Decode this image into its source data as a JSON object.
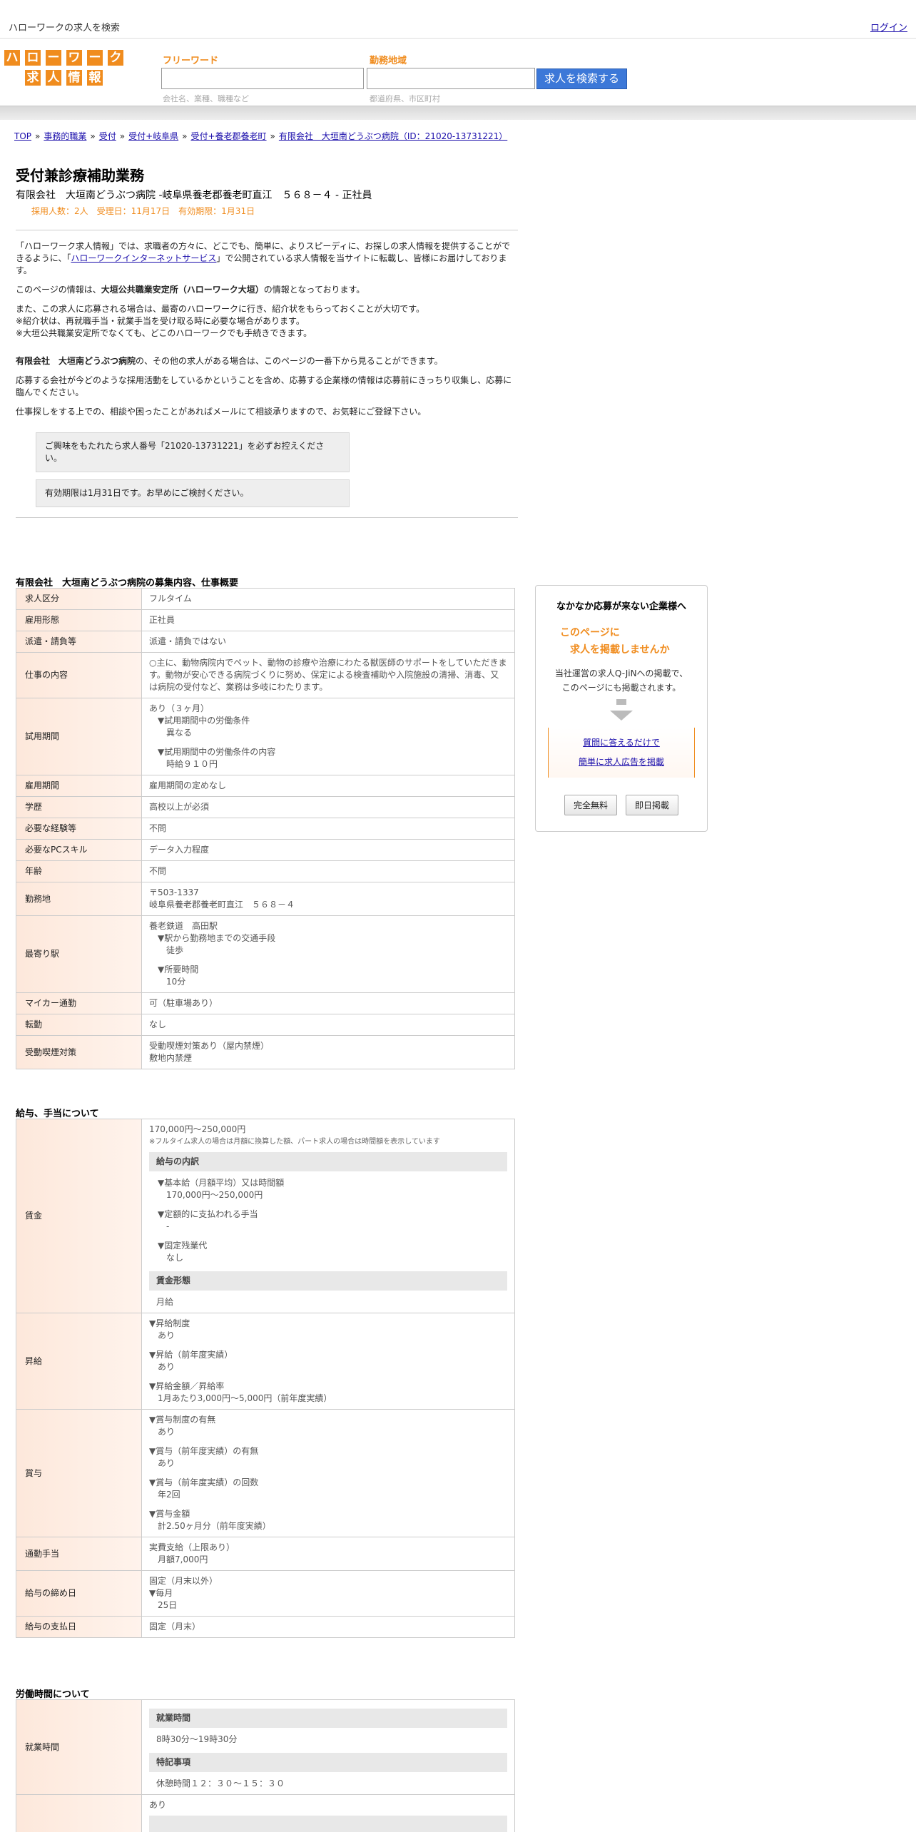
{
  "topbar": {
    "site_title": "ハローワークの求人を検索",
    "login": "ログイン"
  },
  "logo": {
    "row1": [
      "ハ",
      "ロ",
      "ー",
      "ワ",
      "ー",
      "ク"
    ],
    "row2": [
      "求",
      "人",
      "情",
      "報"
    ]
  },
  "search": {
    "freeword_label": "フリーワード",
    "freeword_placeholder": "会社名、業種、職種など",
    "area_label": "勤務地域",
    "area_placeholder": "都道府県、市区町村",
    "button": "求人を検索する"
  },
  "breadcrumb": [
    "TOP",
    "事務的職業",
    "受付",
    "受付+岐阜県",
    "受付+養老郡養老町",
    "有限会社　大垣南どうぶつ病院（ID：21020-13731221）"
  ],
  "job": {
    "title": "受付兼診療補助業務",
    "subtitle": "有限会社　大垣南どうぶつ病院 -岐阜県養老郡養老町直江　５６８－４ - 正社員",
    "meta": "採用人数：2人　受理日：11月17日　有効期限：1月31日"
  },
  "intro": {
    "p1_a": "「ハローワーク求人情報」では、求職者の方々に、どこでも、簡単に、よりスピーディに、お探しの求人情報を提供することができるように、「",
    "p1_link": "ハローワークインターネットサービス",
    "p1_b": "」で公開されている求人情報を当サイトに転載し、皆様にお届けしております。",
    "p2_a": "このページの情報は、",
    "p2_bold": "大垣公共職業安定所（ハローワーク大垣）",
    "p2_b": "の情報となっております。",
    "p3_l1": "また、この求人に応募される場合は、最寄のハローワークに行き、紹介状をもらっておくことが大切です。",
    "p3_l2": "※紹介状は、再就職手当・就業手当を受け取る時に必要な場合があります。",
    "p3_l3": "※大垣公共職業安定所でなくても、どこのハローワークでも手続きできます。",
    "p4_bold": "有限会社　大垣南どうぶつ病院",
    "p4_rest": "の、その他の求人がある場合は、このページの一番下から見ることができます。",
    "p5": "応募する会社が今どのような採用活動をしているかということを含め、応募する企業様の情報は応募前にきっちり収集し、応募に臨んでください。",
    "p6": "仕事探しをする上での、相談や困ったことがあればメールにて相談承りますので、お気軽にご登録下さい。",
    "notice1": "ご興味をもたれたら求人番号「21020-13731221」を必ずお控えください。",
    "notice2": "有効期限は1月31日です。お早めにご検討ください。"
  },
  "overview": {
    "heading": "有限会社　大垣南どうぶつ病院の募集内容、仕事概要",
    "rows": {
      "kubun": [
        "求人区分",
        "フルタイム"
      ],
      "koyo": [
        "雇用形態",
        "正社員"
      ],
      "haken": [
        "派遣・請負等",
        "派遣・請負ではない"
      ],
      "shigoto": [
        "仕事の内容",
        "○主に、動物病院内でペット、動物の診療や治療にわたる獣医師のサポートをしていただきます。動物が安心できる病院づくりに努め、保定による検査補助や入院施設の清掃、消毒、又は病院の受付など、業務は多岐にわたります。"
      ],
      "shiyo_k": "試用期間",
      "shiyo_1": "あり（３ヶ月）",
      "shiyo_2": "▼試用期間中の労働条件",
      "shiyo_3": "異なる",
      "shiyo_4": "▼試用期間中の労働条件の内容",
      "shiyo_5": "時給９１０円",
      "kikan": [
        "雇用期間",
        "雇用期間の定めなし"
      ],
      "gakureki": [
        "学歴",
        "高校以上が必須"
      ],
      "keiken": [
        "必要な経験等",
        "不問"
      ],
      "pc": [
        "必要なPCスキル",
        "データ入力程度"
      ],
      "nenrei": [
        "年齢",
        "不問"
      ],
      "kinmu_k": "勤務地",
      "kinmu_1": "〒503-1337",
      "kinmu_2": "岐阜県養老郡養老町直江　５６８－４",
      "eki_k": "最寄り駅",
      "eki_1": "養老鉄道　高田駅",
      "eki_2": "▼駅から勤務地までの交通手段",
      "eki_3": "徒歩",
      "eki_4": "▼所要時間",
      "eki_5": "10分",
      "mycar": [
        "マイカー通勤",
        "可（駐車場あり）"
      ],
      "tenkin": [
        "転勤",
        "なし"
      ],
      "judo_k": "受動喫煙対策",
      "judo_1": "受動喫煙対策あり（屋内禁煙）",
      "judo_2": "敷地内禁煙"
    }
  },
  "salary": {
    "heading": "給与、手当について",
    "chingin_k": "賃金",
    "chingin_range": "170,000円〜250,000円",
    "chingin_note": "※フルタイム求人の場合は月額に換算した額、パート求人の場合は時間額を表示しています",
    "uchiwake_h": "給与の内訳",
    "kihon_l": "▼基本給（月額平均）又は時間額",
    "kihon_v": "170,000円〜250,000円",
    "teigaku_l": "▼定額的に支払われる手当",
    "teigaku_v": "-",
    "kotei_l": "▼固定残業代",
    "kotei_v": "なし",
    "keitai_h": "賃金形態",
    "keitai_v": "月給",
    "shokyu_k": "昇給",
    "shokyu_1": "▼昇給制度",
    "shokyu_1v": "あり",
    "shokyu_2": "▼昇給（前年度実績）",
    "shokyu_2v": "あり",
    "shokyu_3": "▼昇給金額／昇給率",
    "shokyu_3v": "1月あたり3,000円〜5,000円（前年度実績）",
    "shoyo_k": "賞与",
    "shoyo_1": "▼賞与制度の有無",
    "shoyo_1v": "あり",
    "shoyo_2": "▼賞与（前年度実績）の有無",
    "shoyo_2v": "あり",
    "shoyo_3": "▼賞与（前年度実績）の回数",
    "shoyo_3v": "年2回",
    "shoyo_4": "▼賞与金額",
    "shoyo_4v": "計2.50ヶ月分（前年度実績）",
    "tsukin_k": "通勤手当",
    "tsukin_1": "実費支給（上限あり）",
    "tsukin_2": "月額7,000円",
    "shime_k": "給与の締め日",
    "shime_1": "固定（月末以外）",
    "shime_2": "▼毎月",
    "shime_3": "25日",
    "shiharai": [
      "給与の支払日",
      "固定（月末）"
    ]
  },
  "hours": {
    "heading": "労働時間について",
    "shugyo_k": "就業時間",
    "shugyo_h": "就業時間",
    "shugyo_v": "8時30分〜19時30分",
    "tokki_h": "特記事項",
    "tokki_v": "休憩時間１２：３０～１５：３０",
    "next_v": "あり"
  },
  "sidebar": {
    "title": "なかなか応募が来ない企業様へ",
    "h1": "このページに",
    "h2": "求人を掲載しませんか",
    "p1": "当社運営の求人Q-JiNへの掲載で、",
    "p2": "このページにも掲載されます。",
    "link1": "質問に答えるだけで",
    "link2": "簡単に求人広告を掲載",
    "btn1": "完全無料",
    "btn2": "即日掲載"
  },
  "colors": {
    "accent": "#f08c1e",
    "button_blue": "#3c78d8",
    "key_bg": "#fde8db"
  }
}
